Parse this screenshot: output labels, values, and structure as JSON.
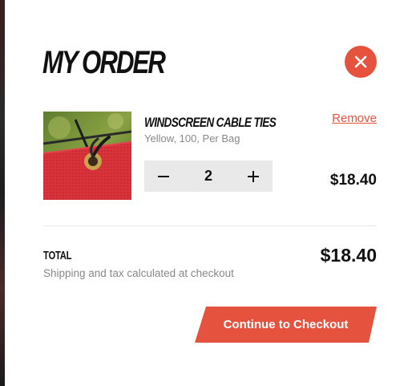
{
  "cart": {
    "title": "MY ORDER",
    "close_icon": "close-icon",
    "item": {
      "name": "WINDSCREEN CABLE TIES",
      "variant": "Yellow, 100, Per Bag",
      "remove_label": "Remove",
      "quantity": "2",
      "line_price": "$18.40",
      "decrement_icon": "minus-icon",
      "increment_icon": "plus-icon"
    },
    "summary": {
      "total_label": "TOTAL",
      "total_value": "$18.40",
      "shipping_note": "Shipping and tax calculated at checkout"
    },
    "checkout_label": "Continue to Checkout"
  },
  "colors": {
    "accent": "#e5533f",
    "text": "#111111",
    "muted": "#888888",
    "stepper_bg": "#e9e9e9"
  }
}
